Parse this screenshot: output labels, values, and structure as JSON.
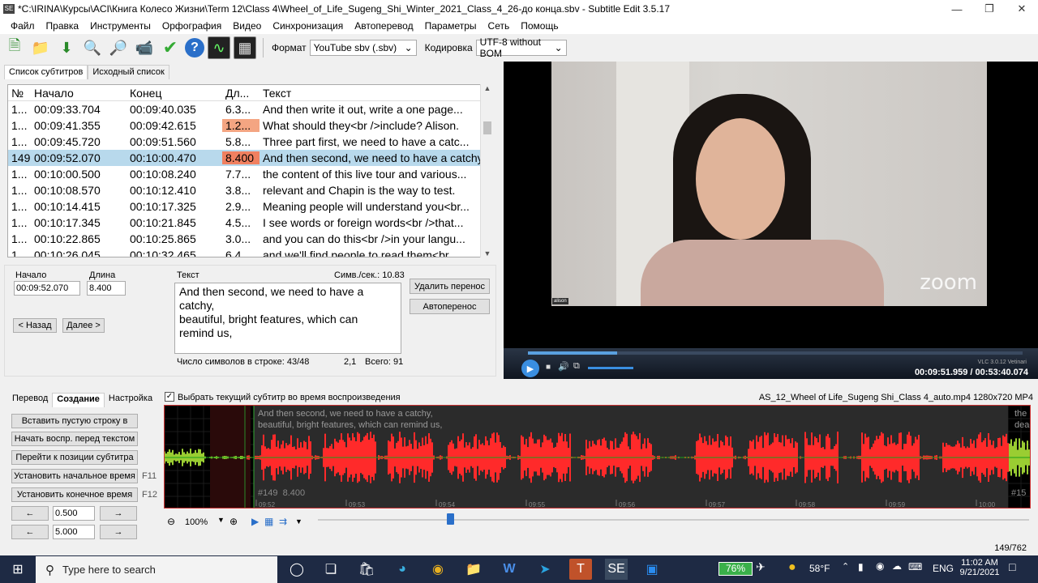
{
  "window": {
    "title": "*C:\\IRINA\\Курсы\\ACI\\Книга Колесо Жизни\\Term 12\\Class 4\\Wheel_of_Life_Sugeng_Shi_Winter_2021_Class_4_26-до конца.sbv - Subtitle Edit 3.5.17",
    "icon_text": "SE"
  },
  "menu": [
    "Файл",
    "Правка",
    "Инструменты",
    "Орфография",
    "Видео",
    "Синхронизация",
    "Автоперевод",
    "Параметры",
    "Сеть",
    "Помощь"
  ],
  "toolbar": {
    "format_label": "Формат",
    "format_value": "YouTube sbv (.sbv)",
    "encoding_label": "Кодировка",
    "encoding_value": "UTF-8 without BOM"
  },
  "list_tabs": [
    "Список субтитров",
    "Исходный список"
  ],
  "grid": {
    "headers": [
      "№",
      "Начало",
      "Конец",
      "Дл...",
      "Текст"
    ],
    "rows": [
      {
        "n": "1...",
        "start": "00:09:33.704",
        "end": "00:09:40.035",
        "dur": "6.3...",
        "text": "And then write it out, write a one page..."
      },
      {
        "n": "1...",
        "start": "00:09:41.355",
        "end": "00:09:42.615",
        "dur": "1.2...",
        "text": "What should they<br />include? Alison."
      },
      {
        "n": "1...",
        "start": "00:09:45.720",
        "end": "00:09:51.560",
        "dur": "5.8...",
        "text": "Three part first, we need to have a catc..."
      },
      {
        "n": "149",
        "start": "00:09:52.070",
        "end": "00:10:00.470",
        "dur": "8.400",
        "text": "And then second, we need to have a catchy"
      },
      {
        "n": "1...",
        "start": "00:10:00.500",
        "end": "00:10:08.240",
        "dur": "7.7...",
        "text": " the content of this live tour and various..."
      },
      {
        "n": "1...",
        "start": "00:10:08.570",
        "end": "00:10:12.410",
        "dur": "3.8...",
        "text": " relevant and Chapin is the way to test."
      },
      {
        "n": "1...",
        "start": "00:10:14.415",
        "end": "00:10:17.325",
        "dur": "2.9...",
        "text": "Meaning people will understand you<br..."
      },
      {
        "n": "1...",
        "start": "00:10:17.345",
        "end": "00:10:21.845",
        "dur": "4.5...",
        "text": "I see words or foreign words<br />that..."
      },
      {
        "n": "1...",
        "start": "00:10:22.865",
        "end": "00:10:25.865",
        "dur": "3.0...",
        "text": "and you can do this<br />in your langu..."
      },
      {
        "n": "1...",
        "start": "00:10:26.045",
        "end": "00:10:32.465",
        "dur": "6.4...",
        "text": " and we'll find people to read them<br..."
      }
    ]
  },
  "edit": {
    "start_label": "Начало",
    "start_value": "00:09:52.070",
    "duration_label": "Длина",
    "duration_value": "8.400",
    "text_label": "Текст",
    "cps": "Симв./сек.: 10.83",
    "text": "And then second, we need to have a\ncatchy,\nbeautiful, bright features, which can\nremind us,",
    "remove_break": "Удалить перенос",
    "auto_break": "Автоперенос",
    "prev": "< Назад",
    "next": "Далее >",
    "line_chars": "Число символов в строке: 43/48",
    "pos": "2,1",
    "total": "Всего: 91"
  },
  "video": {
    "watermark": "zoom",
    "name_tag": "alison",
    "vlc": "VLC 3.0.12 Vetinari",
    "time": "00:09:51.959 / 00:53:40.074",
    "position_fraction": 0.18
  },
  "bottom_tabs": [
    "Перевод",
    "Создание",
    "Настройка"
  ],
  "select_current": "Выбрать текущий субтитр во время воспроизведения",
  "media_info": "AS_12_Wheel of Life_Sugeng Shi_Class 4_auto.mp4 1280x720 MP4",
  "create_buttons": [
    {
      "label": "Вставить пустую строку в",
      "key": ""
    },
    {
      "label": "Начать воспр. перед текстом",
      "key": ""
    },
    {
      "label": "Перейти к позиции субтитра",
      "key": ""
    },
    {
      "label": "Установить начальное время",
      "key": "F11"
    },
    {
      "label": "Установить конечное время",
      "key": "F12"
    }
  ],
  "steppers": [
    {
      "value": "0.500",
      "left": "←",
      "right": "→"
    },
    {
      "value": "5.000",
      "left": "←",
      "right": "→"
    }
  ],
  "waveform": {
    "sub_text": "And then second, we need to have a catchy,\nbeautiful, bright features, which can remind us,",
    "sub_info": "#149  8.400",
    "next_text": "the\ndead",
    "next_info": "#15",
    "ticks": [
      "09:52",
      "09:53",
      "09:54",
      "09:55",
      "09:56",
      "09:57",
      "09:58",
      "09:59",
      "10:00"
    ],
    "zoom": "100%"
  },
  "status": "149/762",
  "taskbar": {
    "search_placeholder": "Type here to search",
    "battery": "76%",
    "temp": "58°F",
    "lang": "ENG",
    "time": "11:02 AM",
    "date": "9/21/2021",
    "notif": "4"
  },
  "colors": {
    "accent": "#0a64a4",
    "wave": "#ff2a2a",
    "wave_other": "#9acd32",
    "selected_row": "#b8d9ec"
  }
}
